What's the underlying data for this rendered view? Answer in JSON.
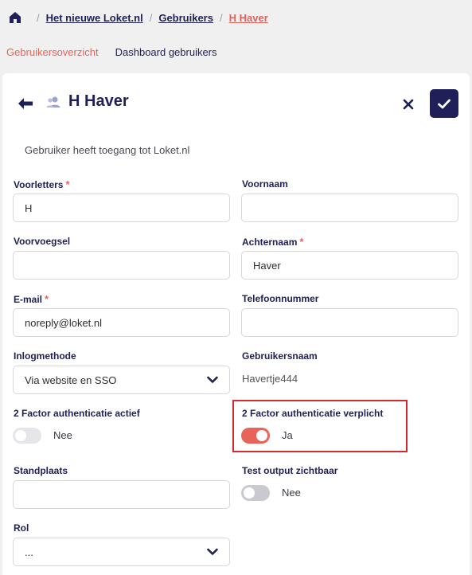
{
  "breadcrumb": {
    "items": [
      "Het nieuwe Loket.nl",
      "Gebruikers",
      "H Haver"
    ],
    "separator": "/"
  },
  "tabs": [
    {
      "label": "Gebruikersoverzicht",
      "active": true
    },
    {
      "label": "Dashboard gebruikers",
      "active": false
    }
  ],
  "header": {
    "title": "H Haver"
  },
  "access_text": "Gebruiker heeft toegang tot Loket.nl",
  "required_marker": "*",
  "fields": {
    "voorletters": {
      "label": "Voorletters",
      "value": "H",
      "required": true
    },
    "voornaam": {
      "label": "Voornaam",
      "value": ""
    },
    "voorvoegsel": {
      "label": "Voorvoegsel",
      "value": ""
    },
    "achternaam": {
      "label": "Achternaam",
      "value": "Haver",
      "required": true
    },
    "email": {
      "label": "E-mail",
      "value": "noreply@loket.nl",
      "required": true
    },
    "telefoonnummer": {
      "label": "Telefoonnummer",
      "value": ""
    },
    "inlogmethode": {
      "label": "Inlogmethode",
      "value": "Via website en SSO"
    },
    "gebruikersnaam": {
      "label": "Gebruikersnaam",
      "value": "Havertje444"
    },
    "twofa_actief": {
      "label": "2 Factor authenticatie actief",
      "state": "Nee",
      "on": false
    },
    "twofa_verplicht": {
      "label": "2 Factor authenticatie verplicht",
      "state": "Ja",
      "on": true
    },
    "standplaats": {
      "label": "Standplaats",
      "value": ""
    },
    "test_output": {
      "label": "Test output zichtbaar",
      "state": "Nee",
      "on": false
    },
    "rol": {
      "label": "Rol",
      "value": "..."
    }
  },
  "colors": {
    "navy": "#1e2057",
    "accent": "#e8635a",
    "highlight": "#d22a2f"
  }
}
